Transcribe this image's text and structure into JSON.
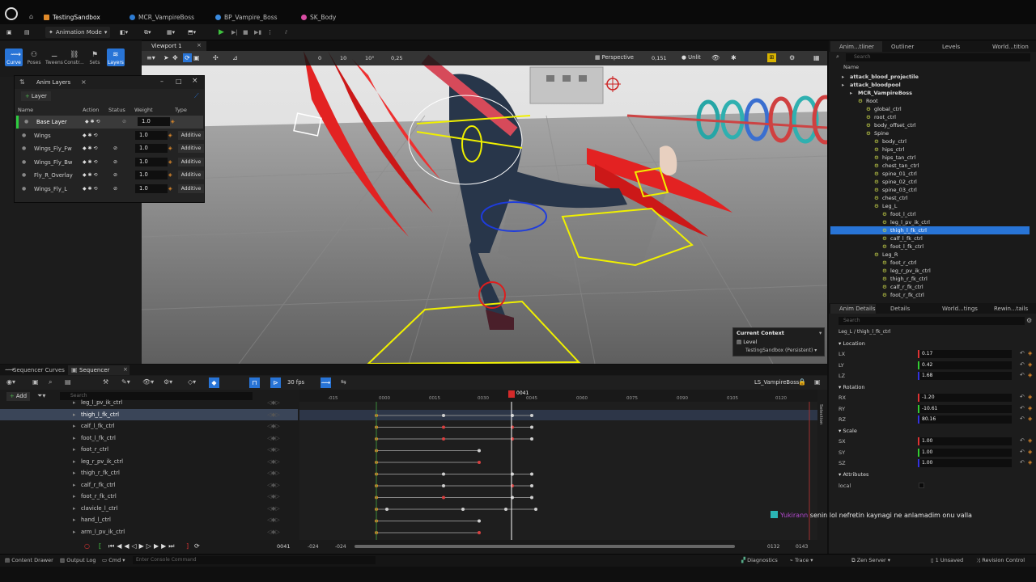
{
  "doc_tabs": [
    "TestingSandbox",
    "MCR_VampireBoss",
    "BP_Vampire_Boss",
    "SK_Body"
  ],
  "toolbar": {
    "mode_label": "Animation Mode"
  },
  "modes": [
    "Curve",
    "Poses",
    "Tweens",
    "Constr...",
    "Sets",
    "Layers"
  ],
  "anim_layers": {
    "title": "Anim Layers",
    "add_label": "Layer",
    "headers": {
      "name": "Name",
      "action": "Action",
      "status": "Status",
      "weight": "Weight",
      "type": "Type"
    },
    "rows": [
      {
        "name": "Base Layer",
        "weight": "1.0",
        "type": ""
      },
      {
        "name": "Wings",
        "weight": "1.0",
        "type": "Additive"
      },
      {
        "name": "Wings_Fly_Fw",
        "weight": "1.0",
        "type": "Additive"
      },
      {
        "name": "Wings_Fly_Bw",
        "weight": "1.0",
        "type": "Additive"
      },
      {
        "name": "Fly_R_Overlay",
        "weight": "1.0",
        "type": "Additive"
      },
      {
        "name": "Wings_Fly_L",
        "weight": "1.0",
        "type": "Additive"
      }
    ]
  },
  "viewport": {
    "tab": "Viewport 1",
    "perspective": "Perspective",
    "speed": "0,151",
    "unlit": "Unlit",
    "snap_deg": "10°",
    "snap_grid": "10",
    "snap_scale": "0,25",
    "snap_zero": "0",
    "context_title": "Current Context",
    "context_level": "Level",
    "context_world": "TestingSandbox (Persistent)"
  },
  "right_tabs": [
    "Anim...tliner",
    "Outliner",
    "Levels",
    "World...tition"
  ],
  "outliner": {
    "search_placeholder": "Search",
    "header": "Name",
    "items": [
      {
        "label": "attack_blood_projectile",
        "indent": 0,
        "bold": true
      },
      {
        "label": "attack_bloodpool",
        "indent": 0,
        "bold": true
      },
      {
        "label": "MCR_VampireBoss",
        "indent": 1,
        "bold": true
      },
      {
        "label": "Root",
        "indent": 2
      },
      {
        "label": "global_ctrl",
        "indent": 3
      },
      {
        "label": "root_ctrl",
        "indent": 3
      },
      {
        "label": "body_offset_ctrl",
        "indent": 3
      },
      {
        "label": "Spine",
        "indent": 3
      },
      {
        "label": "body_ctrl",
        "indent": 4
      },
      {
        "label": "hips_ctrl",
        "indent": 4
      },
      {
        "label": "hips_tan_ctrl",
        "indent": 4
      },
      {
        "label": "chest_tan_ctrl",
        "indent": 4
      },
      {
        "label": "spine_01_ctrl",
        "indent": 4
      },
      {
        "label": "spine_02_ctrl",
        "indent": 4
      },
      {
        "label": "spine_03_ctrl",
        "indent": 4
      },
      {
        "label": "chest_ctrl",
        "indent": 4
      },
      {
        "label": "Leg_L",
        "indent": 4
      },
      {
        "label": "foot_l_ctrl",
        "indent": 5
      },
      {
        "label": "leg_l_pv_ik_ctrl",
        "indent": 5
      },
      {
        "label": "thigh_l_fk_ctrl",
        "indent": 5,
        "selected": true
      },
      {
        "label": "calf_l_fk_ctrl",
        "indent": 5
      },
      {
        "label": "foot_l_fk_ctrl",
        "indent": 5
      },
      {
        "label": "Leg_R",
        "indent": 4
      },
      {
        "label": "foot_r_ctrl",
        "indent": 5
      },
      {
        "label": "leg_r_pv_ik_ctrl",
        "indent": 5
      },
      {
        "label": "thigh_r_fk_ctrl",
        "indent": 5
      },
      {
        "label": "calf_r_fk_ctrl",
        "indent": 5
      },
      {
        "label": "foot_r_fk_ctrl",
        "indent": 5
      }
    ]
  },
  "details_tabs": [
    "Anim Details",
    "Details",
    "World...tings",
    "Rewin...tails"
  ],
  "details": {
    "search_placeholder": "Search",
    "path": "Leg_L / thigh_l_fk_ctrl",
    "location_label": "Location",
    "rotation_label": "Rotation",
    "scale_label": "Scale",
    "attributes_label": "Attributes",
    "local_label": "local",
    "fields": [
      {
        "label": "LX",
        "value": "0.17"
      },
      {
        "label": "LY",
        "value": "0.42"
      },
      {
        "label": "LZ",
        "value": "1.68"
      },
      {
        "label": "RX",
        "value": "-1.20"
      },
      {
        "label": "RY",
        "value": "-10.61"
      },
      {
        "label": "RZ",
        "value": "80.16"
      },
      {
        "label": "SX",
        "value": "1.00"
      },
      {
        "label": "SY",
        "value": "1.00"
      },
      {
        "label": "SZ",
        "value": "1.00"
      }
    ]
  },
  "sequencer": {
    "tabs": [
      "Sequencer Curves",
      "Sequencer"
    ],
    "add_label": "Add",
    "search_placeholder": "Search",
    "fps": "30 fps",
    "sequence_name": "LS_VampireBoss",
    "current_frame": "0041",
    "frame_field": "0041",
    "range_start": "-024",
    "range_start2": "-024",
    "range_end": "0132",
    "range_end2": "0143",
    "ticks": [
      "-015",
      "0000",
      "0015",
      "0030",
      "0045",
      "0060",
      "0075",
      "0090",
      "0105",
      "0120"
    ],
    "selection_label": "Selection",
    "tracks": [
      "leg_l_pv_ik_ctrl",
      "thigh_l_fk_ctrl",
      "calf_l_fk_ctrl",
      "foot_l_fk_ctrl",
      "foot_r_ctrl",
      "leg_r_pv_ik_ctrl",
      "thigh_r_fk_ctrl",
      "calf_r_fk_ctrl",
      "foot_r_fk_ctrl",
      "clavicle_l_ctrl",
      "hand_l_ctrl",
      "arm_l_pv_ik_ctrl"
    ]
  },
  "status": {
    "content_drawer": "Content Drawer",
    "output_log": "Output Log",
    "cmd": "Cmd",
    "console_placeholder": "Enter Console Command",
    "diagnostics": "Diagnostics",
    "trace": "Trace",
    "zen_server": "Zen Server",
    "unsaved": "1 Unsaved",
    "revision": "Revision Control"
  },
  "chat": {
    "user": "Yukirann",
    "message": "senin lol nefretin kaynagi ne anlamadim onu valla"
  }
}
